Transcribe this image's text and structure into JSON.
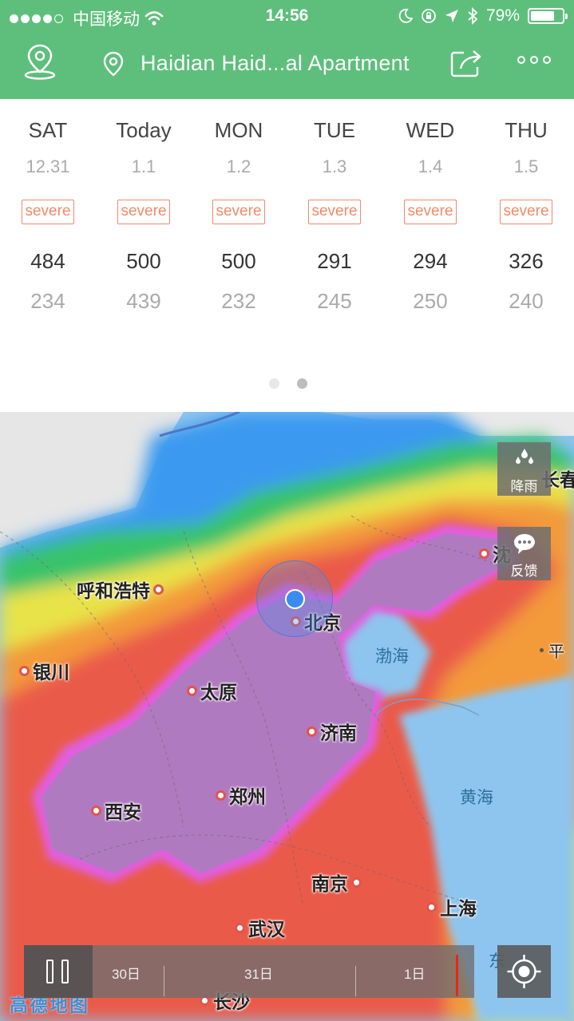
{
  "status_bar": {
    "carrier": "中国移动",
    "time": "14:56",
    "battery_text": "79%",
    "battery_level": 0.79
  },
  "nav": {
    "title": "Haidian Haid...al Apartment"
  },
  "forecast": {
    "days": [
      {
        "day": "SAT",
        "date": "12.31",
        "badge": "severe",
        "high": "484",
        "low": "234"
      },
      {
        "day": "Today",
        "date": "1.1",
        "badge": "severe",
        "high": "500",
        "low": "439"
      },
      {
        "day": "MON",
        "date": "1.2",
        "badge": "severe",
        "high": "500",
        "low": "232"
      },
      {
        "day": "TUE",
        "date": "1.3",
        "badge": "severe",
        "high": "291",
        "low": "245"
      },
      {
        "day": "WED",
        "date": "1.4",
        "badge": "severe",
        "high": "294",
        "low": "250"
      },
      {
        "day": "THU",
        "date": "1.5",
        "badge": "severe",
        "high": "326",
        "low": "240"
      }
    ],
    "page_index": 2,
    "page_count": 2
  },
  "map": {
    "cities": [
      "呼和浩特",
      "银川",
      "北京",
      "太原",
      "济南",
      "西安",
      "郑州",
      "南京",
      "上海",
      "武汉",
      "长沙",
      "沈阳",
      "长春"
    ],
    "partial_labels": {
      "shenyang": "沈",
      "changchun": "长春",
      "pyongyang": "平",
      "east_sea": "东"
    },
    "seas": [
      "渤海",
      "黄海"
    ],
    "rain_button": "降雨",
    "feedback_button": "反馈",
    "provider": "高德地图"
  },
  "timeline": {
    "labels": [
      "30日",
      "31日",
      "1日"
    ]
  },
  "colors": {
    "header": "#5dbf7b",
    "badge": "#f08a6a",
    "severe_purple": "#b07ac0"
  }
}
